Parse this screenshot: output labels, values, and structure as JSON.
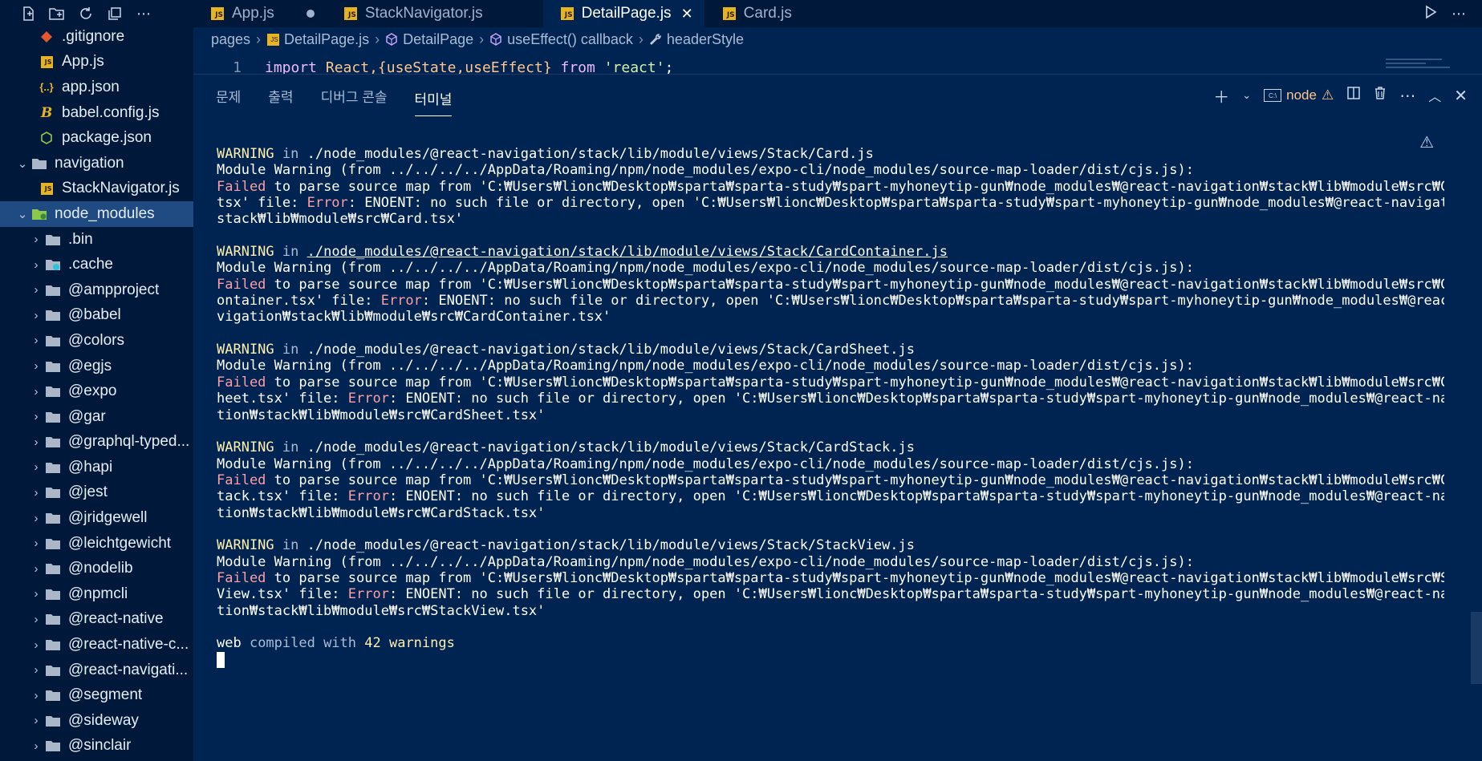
{
  "explorer": {
    "items": [
      {
        "label": ".gitignore",
        "icon": "git-file-icon",
        "depth": 2,
        "chevron": ""
      },
      {
        "label": "App.js",
        "icon": "js-file-icon",
        "depth": 2,
        "chevron": ""
      },
      {
        "label": "app.json",
        "icon": "json-file-icon",
        "depth": 2,
        "chevron": ""
      },
      {
        "label": "babel.config.js",
        "icon": "babel-file-icon",
        "depth": 2,
        "chevron": ""
      },
      {
        "label": "package.json",
        "icon": "npm-file-icon",
        "depth": 2,
        "chevron": ""
      },
      {
        "label": "navigation",
        "icon": "folder-icon",
        "depth": 1,
        "chevron": "⌄"
      },
      {
        "label": "StackNavigator.js",
        "icon": "js-file-icon",
        "depth": 2,
        "chevron": ""
      },
      {
        "label": "node_modules",
        "icon": "node-folder-icon",
        "depth": 1,
        "chevron": "⌄",
        "selected": true
      },
      {
        "label": ".bin",
        "icon": "folder-icon",
        "depth": 2,
        "chevron": "›"
      },
      {
        "label": ".cache",
        "icon": "cache-folder-icon",
        "depth": 2,
        "chevron": "›"
      },
      {
        "label": "@ampproject",
        "icon": "folder-icon",
        "depth": 2,
        "chevron": "›"
      },
      {
        "label": "@babel",
        "icon": "folder-icon",
        "depth": 2,
        "chevron": "›"
      },
      {
        "label": "@colors",
        "icon": "folder-icon",
        "depth": 2,
        "chevron": "›"
      },
      {
        "label": "@egjs",
        "icon": "folder-icon",
        "depth": 2,
        "chevron": "›"
      },
      {
        "label": "@expo",
        "icon": "folder-icon",
        "depth": 2,
        "chevron": "›"
      },
      {
        "label": "@gar",
        "icon": "folder-icon",
        "depth": 2,
        "chevron": "›"
      },
      {
        "label": "@graphql-typed...",
        "icon": "folder-icon",
        "depth": 2,
        "chevron": "›"
      },
      {
        "label": "@hapi",
        "icon": "folder-icon",
        "depth": 2,
        "chevron": "›"
      },
      {
        "label": "@jest",
        "icon": "folder-icon",
        "depth": 2,
        "chevron": "›"
      },
      {
        "label": "@jridgewell",
        "icon": "folder-icon",
        "depth": 2,
        "chevron": "›"
      },
      {
        "label": "@leichtgewicht",
        "icon": "folder-icon",
        "depth": 2,
        "chevron": "›"
      },
      {
        "label": "@nodelib",
        "icon": "folder-icon",
        "depth": 2,
        "chevron": "›"
      },
      {
        "label": "@npmcli",
        "icon": "folder-icon",
        "depth": 2,
        "chevron": "›"
      },
      {
        "label": "@react-native",
        "icon": "folder-icon",
        "depth": 2,
        "chevron": "›"
      },
      {
        "label": "@react-native-c...",
        "icon": "folder-icon",
        "depth": 2,
        "chevron": "›"
      },
      {
        "label": "@react-navigati...",
        "icon": "folder-icon",
        "depth": 2,
        "chevron": "›"
      },
      {
        "label": "@segment",
        "icon": "folder-icon",
        "depth": 2,
        "chevron": "›"
      },
      {
        "label": "@sideway",
        "icon": "folder-icon",
        "depth": 2,
        "chevron": "›"
      },
      {
        "label": "@sinclair",
        "icon": "folder-icon",
        "depth": 2,
        "chevron": "›"
      }
    ]
  },
  "tabs": [
    {
      "label": "App.js",
      "modified": true,
      "active": false
    },
    {
      "label": "StackNavigator.js",
      "modified": false,
      "active": false
    },
    {
      "label": "DetailPage.js",
      "modified": false,
      "active": true
    },
    {
      "label": "Card.js",
      "modified": false,
      "active": false
    }
  ],
  "breadcrumb": {
    "items": [
      "pages",
      "DetailPage.js",
      "DetailPage",
      "useEffect() callback",
      "headerStyle"
    ]
  },
  "editor": {
    "line_number": "1",
    "code": {
      "kw1": "import",
      "id1": "React",
      "mid": ",{useState,useEffect} ",
      "kw2": "from",
      "str": "'react'",
      "end": ";"
    }
  },
  "panel": {
    "tabs": [
      "문제",
      "출력",
      "디버그 콘솔",
      "터미널"
    ],
    "active_tab": "터미널",
    "terminal_name": "node"
  },
  "terminal": {
    "lines": [
      [
        {
          "t": "WARNING",
          "c": "warn"
        },
        {
          "t": " in ",
          "c": "dim"
        },
        {
          "t": "./node_modules/@react-navigation/stack/lib/module/views/Stack/Card.js",
          "c": ""
        }
      ],
      [
        {
          "t": "Module Warning (from ../../../../AppData/Roaming/npm/node_modules/expo-cli/node_modules/source-map-loader/dist/cjs.js):",
          "c": ""
        }
      ],
      [
        {
          "t": "Failed",
          "c": "red"
        },
        {
          "t": " to parse source map from 'C:₩Users₩lionc₩Desktop₩sparta₩sparta-study₩spart-myhoneytip-gun₩node_modules₩@react-navigation₩stack₩lib₩module₩src₩Card.",
          "c": ""
        }
      ],
      [
        {
          "t": "tsx' file: ",
          "c": ""
        },
        {
          "t": "Error",
          "c": "red"
        },
        {
          "t": ": ENOENT: no such file or directory, open 'C:₩Users₩lionc₩Desktop₩sparta₩sparta-study₩spart-myhoneytip-gun₩node_modules₩@react-navigation₩",
          "c": ""
        }
      ],
      [
        {
          "t": "stack₩lib₩module₩src₩Card.tsx'",
          "c": ""
        }
      ],
      [
        {
          "t": "",
          "c": ""
        }
      ],
      [
        {
          "t": "WARNING",
          "c": "warn"
        },
        {
          "t": " in ",
          "c": "dim"
        },
        {
          "t": "./node_modules/@react-navigation/stack/lib/module/views/Stack/CardContainer.js",
          "c": "under"
        }
      ],
      [
        {
          "t": "Module Warning (from ../../../../AppData/Roaming/npm/node_modules/expo-cli/node_modules/source-map-loader/dist/cjs.js):",
          "c": ""
        }
      ],
      [
        {
          "t": "Failed",
          "c": "red"
        },
        {
          "t": " to parse source map from 'C:₩Users₩lionc₩Desktop₩sparta₩sparta-study₩spart-myhoneytip-gun₩node_modules₩@react-navigation₩stack₩lib₩module₩src₩CardC",
          "c": ""
        }
      ],
      [
        {
          "t": "ontainer.tsx' file: ",
          "c": ""
        },
        {
          "t": "Error",
          "c": "red"
        },
        {
          "t": ": ENOENT: no such file or directory, open 'C:₩Users₩lionc₩Desktop₩sparta₩sparta-study₩spart-myhoneytip-gun₩node_modules₩@react-na",
          "c": ""
        }
      ],
      [
        {
          "t": "vigation₩stack₩lib₩module₩src₩CardContainer.tsx'",
          "c": ""
        }
      ],
      [
        {
          "t": "",
          "c": ""
        }
      ],
      [
        {
          "t": "WARNING",
          "c": "warn"
        },
        {
          "t": " in ",
          "c": "dim"
        },
        {
          "t": "./node_modules/@react-navigation/stack/lib/module/views/Stack/CardSheet.js",
          "c": ""
        }
      ],
      [
        {
          "t": "Module Warning (from ../../../../AppData/Roaming/npm/node_modules/expo-cli/node_modules/source-map-loader/dist/cjs.js):",
          "c": ""
        }
      ],
      [
        {
          "t": "Failed",
          "c": "red"
        },
        {
          "t": " to parse source map from 'C:₩Users₩lionc₩Desktop₩sparta₩sparta-study₩spart-myhoneytip-gun₩node_modules₩@react-navigation₩stack₩lib₩module₩src₩CardS",
          "c": ""
        }
      ],
      [
        {
          "t": "heet.tsx' file: ",
          "c": ""
        },
        {
          "t": "Error",
          "c": "red"
        },
        {
          "t": ": ENOENT: no such file or directory, open 'C:₩Users₩lionc₩Desktop₩sparta₩sparta-study₩spart-myhoneytip-gun₩node_modules₩@react-naviga",
          "c": ""
        }
      ],
      [
        {
          "t": "tion₩stack₩lib₩module₩src₩CardSheet.tsx'",
          "c": ""
        }
      ],
      [
        {
          "t": "",
          "c": ""
        }
      ],
      [
        {
          "t": "WARNING",
          "c": "warn"
        },
        {
          "t": " in ",
          "c": "dim"
        },
        {
          "t": "./node_modules/@react-navigation/stack/lib/module/views/Stack/CardStack.js",
          "c": ""
        }
      ],
      [
        {
          "t": "Module Warning (from ../../../../AppData/Roaming/npm/node_modules/expo-cli/node_modules/source-map-loader/dist/cjs.js):",
          "c": ""
        }
      ],
      [
        {
          "t": "Failed",
          "c": "red"
        },
        {
          "t": " to parse source map from 'C:₩Users₩lionc₩Desktop₩sparta₩sparta-study₩spart-myhoneytip-gun₩node_modules₩@react-navigation₩stack₩lib₩module₩src₩CardS",
          "c": ""
        }
      ],
      [
        {
          "t": "tack.tsx' file: ",
          "c": ""
        },
        {
          "t": "Error",
          "c": "red"
        },
        {
          "t": ": ENOENT: no such file or directory, open 'C:₩Users₩lionc₩Desktop₩sparta₩sparta-study₩spart-myhoneytip-gun₩node_modules₩@react-naviga",
          "c": ""
        }
      ],
      [
        {
          "t": "tion₩stack₩lib₩module₩src₩CardStack.tsx'",
          "c": ""
        }
      ],
      [
        {
          "t": "",
          "c": ""
        }
      ],
      [
        {
          "t": "WARNING",
          "c": "warn"
        },
        {
          "t": " in ",
          "c": "dim"
        },
        {
          "t": "./node_modules/@react-navigation/stack/lib/module/views/Stack/StackView.js",
          "c": ""
        }
      ],
      [
        {
          "t": "Module Warning (from ../../../../AppData/Roaming/npm/node_modules/expo-cli/node_modules/source-map-loader/dist/cjs.js):",
          "c": ""
        }
      ],
      [
        {
          "t": "Failed",
          "c": "red"
        },
        {
          "t": " to parse source map from 'C:₩Users₩lionc₩Desktop₩sparta₩sparta-study₩spart-myhoneytip-gun₩node_modules₩@react-navigation₩stack₩lib₩module₩src₩Stack",
          "c": ""
        }
      ],
      [
        {
          "t": "View.tsx' file: ",
          "c": ""
        },
        {
          "t": "Error",
          "c": "red"
        },
        {
          "t": ": ENOENT: no such file or directory, open 'C:₩Users₩lionc₩Desktop₩sparta₩sparta-study₩spart-myhoneytip-gun₩node_modules₩@react-naviga",
          "c": ""
        }
      ],
      [
        {
          "t": "tion₩stack₩lib₩module₩src₩StackView.tsx'",
          "c": ""
        }
      ],
      [
        {
          "t": "",
          "c": ""
        }
      ],
      [
        {
          "t": "web",
          "c": ""
        },
        {
          "t": " compiled with ",
          "c": "dim"
        },
        {
          "t": "42",
          "c": "yellow"
        },
        {
          "t": " warnings",
          "c": "yellow"
        }
      ]
    ]
  },
  "colors": {
    "background": "#002451",
    "sidebar": "#00193a",
    "selection": "#1f4a82",
    "warning": "#ffeead",
    "error": "#ff9da4"
  }
}
